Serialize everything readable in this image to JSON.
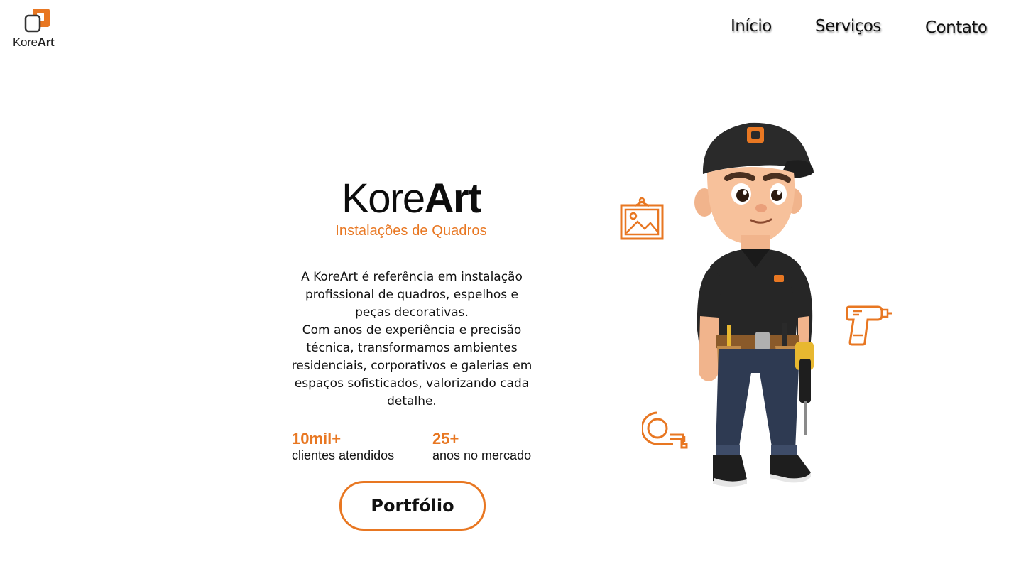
{
  "header": {
    "logo": {
      "text_light": "Kore",
      "text_bold": "Art"
    },
    "nav": [
      {
        "label": "Início"
      },
      {
        "label": "Serviços"
      },
      {
        "label": "Contato"
      }
    ]
  },
  "hero": {
    "brand_light": "Kore",
    "brand_bold": "Art",
    "tagline": "Instalações de Quadros",
    "description": [
      "A KoreArt é referência em instalação profissional de quadros, espelhos e peças decorativas.",
      "Com anos de experiência e precisão técnica, transformamos ambientes residenciais, corporativos e galerias em espaços sofisticados, valorizando cada detalhe."
    ],
    "stats": [
      {
        "value": "10mil+",
        "label": "clientes atendidos"
      },
      {
        "value": "25+",
        "label": "anos no mercado"
      }
    ],
    "cta_label": "Portfólio"
  },
  "icons": {
    "frame": "picture-frame-icon",
    "drill": "drill-icon",
    "tape": "tape-measure-icon",
    "mascot": "installer-mascot"
  },
  "colors": {
    "accent": "#e87722",
    "text": "#111111",
    "background": "#ffffff"
  }
}
